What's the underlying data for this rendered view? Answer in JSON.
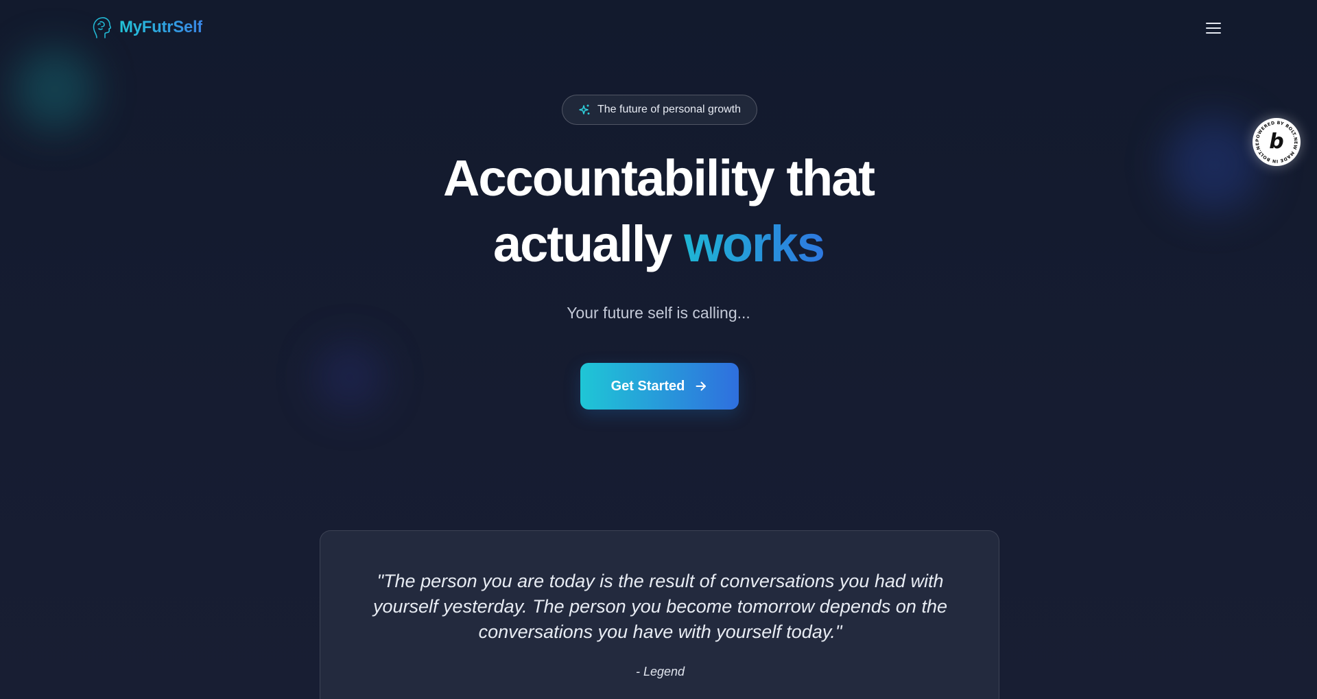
{
  "header": {
    "brand_name": "MyFutrSelf",
    "brand_icon": "head-profile-icon",
    "menu_icon": "hamburger-menu-icon"
  },
  "badge": {
    "ring_text": "POWERED BY BOLT.NEW MADE IN BOLT.NEW",
    "letter": "b"
  },
  "hero": {
    "pill_icon": "sparkles-icon",
    "pill_text": "The future of personal growth",
    "headline_line1": "Accountability that",
    "headline_line2_prefix": "actually",
    "headline_line2_accent": "works",
    "subtitle": "Your future self is calling...",
    "cta_label": "Get Started",
    "cta_icon": "arrow-right-icon"
  },
  "quote": {
    "text": "\"The person you are today is the result of conversations you had with yourself yesterday. The person you become tomorrow depends on the conversations you have with yourself today.\"",
    "author": "- Legend"
  },
  "colors": {
    "background": "#141a2c",
    "accent_start": "#1fc6d6",
    "accent_end": "#2f6fde",
    "card": "#232a3e"
  }
}
